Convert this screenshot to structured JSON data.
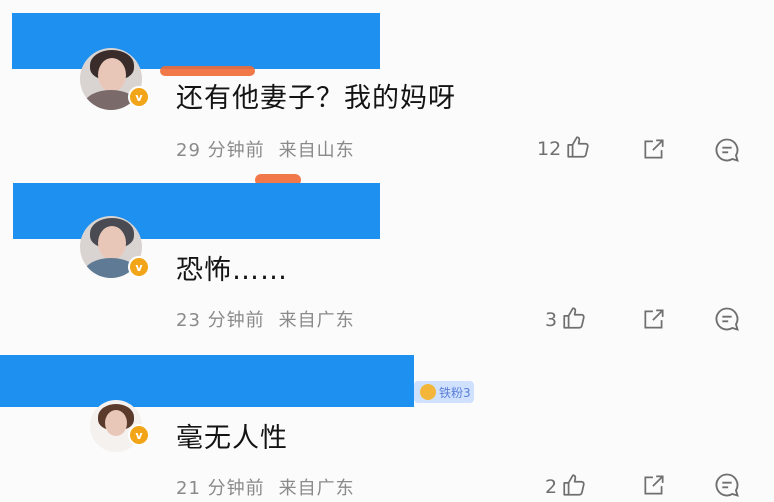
{
  "comments": [
    {
      "text": "还有他妻子？我的妈呀",
      "time": "29 分钟前",
      "location": "来自山东",
      "likes": "12",
      "badge": "v"
    },
    {
      "text": "恐怖……",
      "time": "23 分钟前",
      "location": "来自广东",
      "likes": "3",
      "badge": "v"
    },
    {
      "text": "毫无人性",
      "time": "21 分钟前",
      "location": "来自广东",
      "likes": "2",
      "badge": "v",
      "fan_badge": "铁粉3"
    }
  ],
  "colors": {
    "redaction": "#1e90f0",
    "badge": "#f3a51a",
    "scribble": "#ef6a35"
  },
  "icons": [
    "thumbs-up-icon",
    "share-icon",
    "reply-icon"
  ]
}
